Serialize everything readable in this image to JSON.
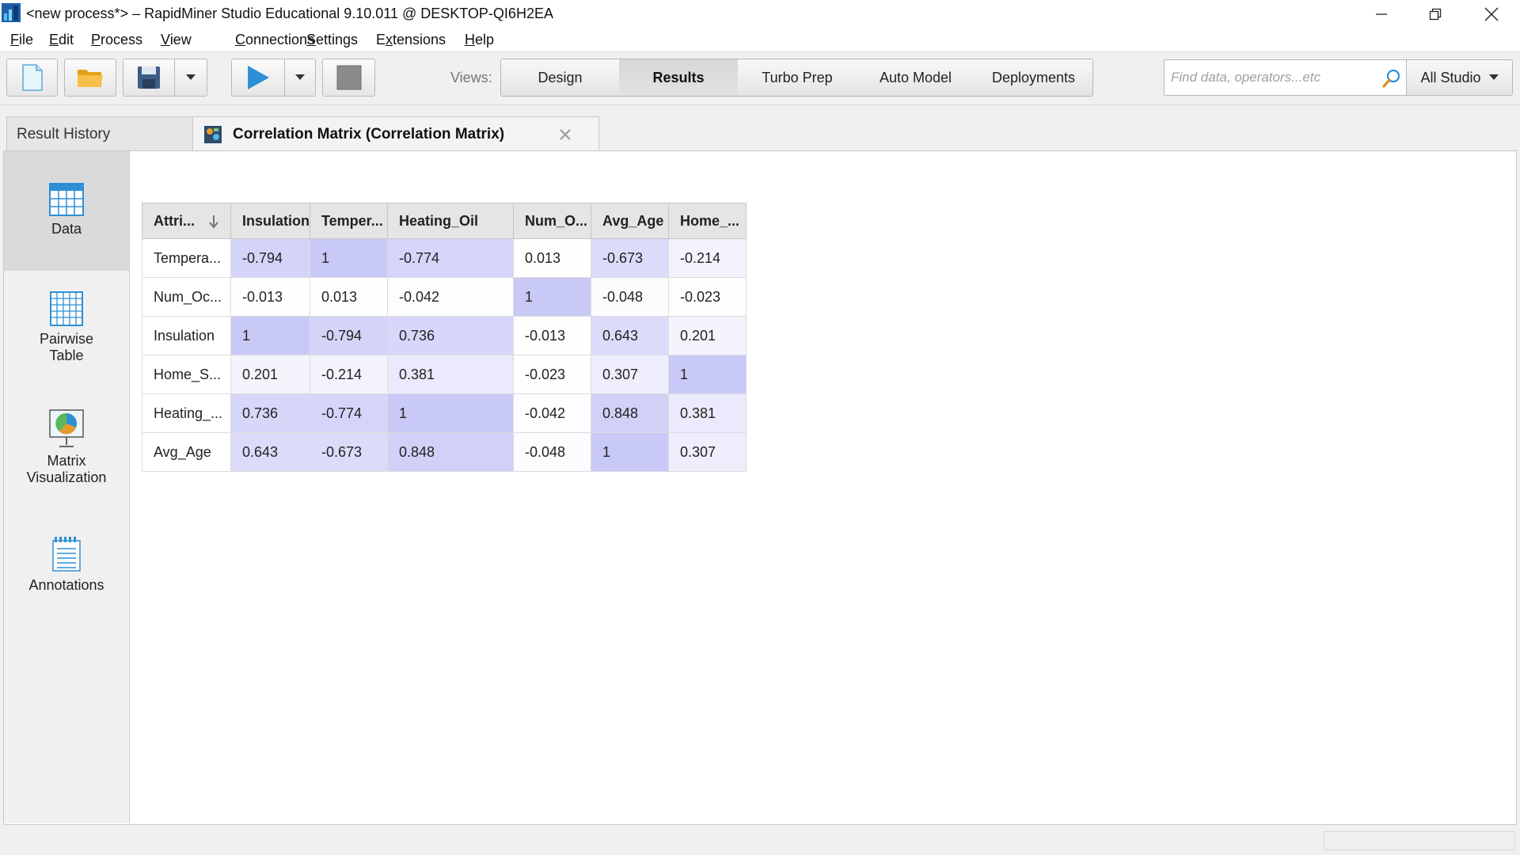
{
  "window": {
    "title": "<new process*> – RapidMiner Studio Educational 9.10.011 @ DESKTOP-QI6H2EA"
  },
  "menu": [
    {
      "pre": "",
      "ul": "F",
      "post": "ile"
    },
    {
      "pre": "",
      "ul": "E",
      "post": "dit"
    },
    {
      "pre": "",
      "ul": "P",
      "post": "rocess"
    },
    {
      "pre": "",
      "ul": "V",
      "post": "iew"
    },
    {
      "pre": "",
      "ul": "C",
      "post": "onnections"
    },
    {
      "pre": "",
      "ul": "S",
      "post": "ettings"
    },
    {
      "pre": "E",
      "ul": "x",
      "post": "tensions"
    },
    {
      "pre": "",
      "ul": "H",
      "post": "elp"
    }
  ],
  "toolbar": {
    "views_label": "Views:",
    "views": [
      "Design",
      "Results",
      "Turbo Prep",
      "Auto Model",
      "Deployments"
    ],
    "active_view": "Results",
    "search_placeholder": "Find data, operators...etc",
    "scope_label": "All Studio"
  },
  "tabs": {
    "history": "Result History",
    "active": "Correlation Matrix (Correlation Matrix)"
  },
  "side": {
    "items": [
      "Data",
      "Pairwise\nTable",
      "Matrix\nVisualization",
      "Annotations"
    ]
  },
  "table": {
    "headers": [
      "Attri...",
      "Insulation",
      "Temper...",
      "Heating_Oil",
      "Num_O...",
      "Avg_Age",
      "Home_..."
    ],
    "rows": [
      {
        "label": "Tempera...",
        "values": [
          "-0.794",
          "1",
          "-0.774",
          "0.013",
          "-0.673",
          "-0.214"
        ],
        "shade": [
          0.794,
          1,
          0.774,
          0.013,
          0.673,
          0.214
        ]
      },
      {
        "label": "Num_Oc...",
        "values": [
          "-0.013",
          "0.013",
          "-0.042",
          "1",
          "-0.048",
          "-0.023"
        ],
        "shade": [
          0.013,
          0.013,
          0.042,
          1,
          0.048,
          0.023
        ]
      },
      {
        "label": "Insulation",
        "values": [
          "1",
          "-0.794",
          "0.736",
          "-0.013",
          "0.643",
          "0.201"
        ],
        "shade": [
          1,
          0.794,
          0.736,
          0.013,
          0.643,
          0.201
        ]
      },
      {
        "label": "Home_S...",
        "values": [
          "0.201",
          "-0.214",
          "0.381",
          "-0.023",
          "0.307",
          "1"
        ],
        "shade": [
          0.201,
          0.214,
          0.381,
          0.023,
          0.307,
          1
        ]
      },
      {
        "label": "Heating_...",
        "values": [
          "0.736",
          "-0.774",
          "1",
          "-0.042",
          "0.848",
          "0.381"
        ],
        "shade": [
          0.736,
          0.774,
          1,
          0.042,
          0.848,
          0.381
        ]
      },
      {
        "label": "Avg_Age",
        "values": [
          "0.643",
          "-0.673",
          "0.848",
          "-0.048",
          "1",
          "0.307"
        ],
        "shade": [
          0.643,
          0.673,
          0.848,
          0.048,
          1,
          0.307
        ]
      }
    ]
  },
  "colors": {
    "accent_blue": "#2f8fd6",
    "cell_max": "#c9c9f7",
    "cell_min": "#ffffff"
  }
}
